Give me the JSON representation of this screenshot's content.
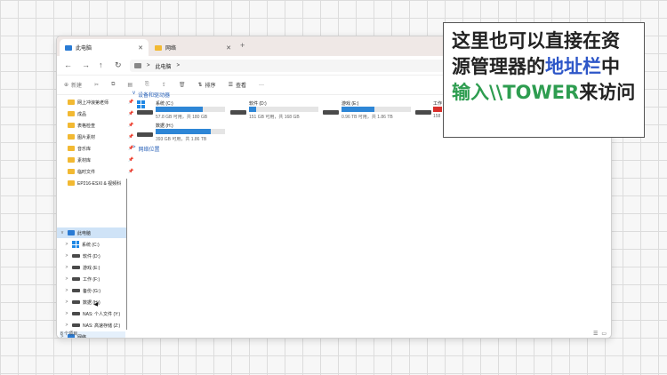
{
  "tabs": [
    {
      "label": "此电脑",
      "active": true
    },
    {
      "label": "网络",
      "active": false
    }
  ],
  "breadcrumb": {
    "root": "此电脑",
    "sep": ">"
  },
  "toolbar": {
    "new": "新建",
    "sort": "排序",
    "view": "查看",
    "more": "···"
  },
  "sidebar": {
    "pinned": [
      "网上冲浪第老师",
      "成品",
      "表格检查",
      "图片素材",
      "音乐库",
      "素材库",
      "临时文件",
      "EP216-ESXI & 视频科"
    ],
    "this_pc": "此电脑",
    "drives": [
      "系统 (C:)",
      "软件 (D:)",
      "游戏 (E:)",
      "工作 (F:)",
      "备份 (G:)",
      "数据 (H:)",
      "NAS: 个人文件 (Y:)",
      "NAS: 高速存储 (Z:)"
    ],
    "network": "网络"
  },
  "content": {
    "drives_header": "设备和驱动器",
    "network_header": "网络位置",
    "drives": [
      {
        "name": "系统 (C:)",
        "status": "57.8 GB 可用，共 180 GB",
        "fill": 0.68,
        "color": "#2e86d6"
      },
      {
        "name": "软件 (D:)",
        "status": "151 GB 可用，共 168 GB",
        "fill": 0.1,
        "color": "#2e86d6"
      },
      {
        "name": "游戏 (E:)",
        "status": "0.96 TB 可用，共 1.86 TB",
        "fill": 0.48,
        "color": "#2e86d6"
      },
      {
        "name": "工作",
        "status": "158",
        "fill": 0.95,
        "color": "#d9302c"
      },
      {
        "name": "数据 (H:)",
        "status": "393 GB 可用，共 1.86 TB",
        "fill": 0.79,
        "color": "#2e86d6"
      }
    ]
  },
  "status_bar": "8 个项目",
  "callout": {
    "part1": "这里也可以直接在资源管理器的",
    "highlight1": "地址栏",
    "part2": "中",
    "highlight2": "输入\\\\TOWER",
    "part3": "来访问"
  }
}
